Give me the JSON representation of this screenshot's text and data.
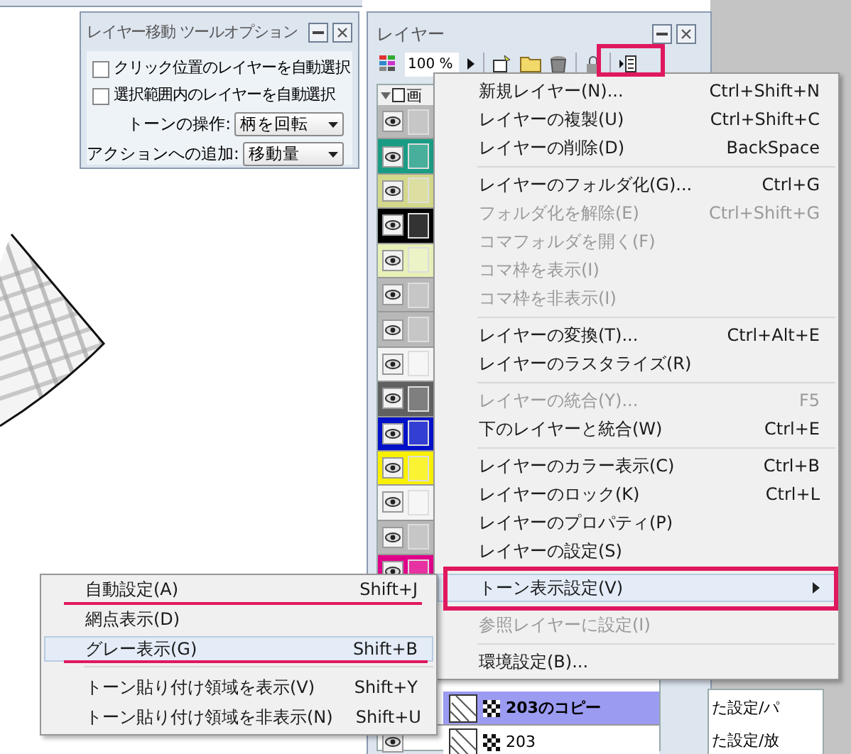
{
  "tool_options": {
    "title": "レイヤー移動 ツールオプション",
    "checkboxes": [
      {
        "label": "クリック位置のレイヤーを自動選択",
        "checked": false
      },
      {
        "label": "選択範囲内のレイヤーを自動選択",
        "checked": false
      }
    ],
    "selects": [
      {
        "label": "トーンの操作:",
        "value": "柄を回転"
      },
      {
        "label": "アクションへの追加:",
        "value": "移動量"
      }
    ]
  },
  "layer_panel": {
    "title": "レイヤー",
    "opacity": "100 %",
    "header": "画",
    "swatches": [
      {
        "color": "#b8b8b8"
      },
      {
        "color": "#1a9c84"
      },
      {
        "color": "#d4d88a"
      },
      {
        "color": "#000000"
      },
      {
        "color": "#e8f0b8"
      },
      {
        "color": "#b8b8b8"
      },
      {
        "color": "#b8b8b8"
      },
      {
        "color": "#f4f4f4"
      },
      {
        "color": "#606060"
      },
      {
        "color": "#0010c8"
      },
      {
        "color": "#f8f000"
      },
      {
        "color": "#f4f4f4"
      },
      {
        "color": "#b8b8b8"
      },
      {
        "color": "#e0008a"
      }
    ],
    "layers": [
      {
        "name": "203のコピー",
        "selected": true
      },
      {
        "name": "203",
        "selected": false
      }
    ]
  },
  "side_panel": {
    "lines": [
      "た設定/パ",
      "た設定/放"
    ]
  },
  "context_menu": {
    "items": [
      {
        "kind": "item",
        "label": "新規レイヤー(N)...",
        "shortcut": "Ctrl+Shift+N",
        "disabled": false,
        "selected": false
      },
      {
        "kind": "item",
        "label": "レイヤーの複製(U)",
        "shortcut": "Ctrl+Shift+C",
        "disabled": false,
        "selected": false
      },
      {
        "kind": "item",
        "label": "レイヤーの削除(D)",
        "shortcut": "BackSpace",
        "disabled": false,
        "selected": false
      },
      {
        "kind": "separator"
      },
      {
        "kind": "item",
        "label": "レイヤーのフォルダ化(G)...",
        "shortcut": "Ctrl+G",
        "disabled": false,
        "selected": false
      },
      {
        "kind": "item",
        "label": "フォルダ化を解除(E)",
        "shortcut": "Ctrl+Shift+G",
        "disabled": true,
        "selected": false
      },
      {
        "kind": "item",
        "label": "コマフォルダを開く(F)",
        "disabled": true,
        "selected": false
      },
      {
        "kind": "item",
        "label": "コマ枠を表示(I)",
        "disabled": true,
        "selected": false
      },
      {
        "kind": "item",
        "label": "コマ枠を非表示(I)",
        "disabled": true,
        "selected": false
      },
      {
        "kind": "separator"
      },
      {
        "kind": "item",
        "label": "レイヤーの変換(T)...",
        "shortcut": "Ctrl+Alt+E",
        "disabled": false,
        "selected": false
      },
      {
        "kind": "item",
        "label": "レイヤーのラスタライズ(R)",
        "disabled": false,
        "selected": false
      },
      {
        "kind": "separator"
      },
      {
        "kind": "item",
        "label": "レイヤーの統合(Y)...",
        "shortcut": "F5",
        "disabled": true,
        "selected": false
      },
      {
        "kind": "item",
        "label": "下のレイヤーと統合(W)",
        "shortcut": "Ctrl+E",
        "disabled": false,
        "selected": false
      },
      {
        "kind": "separator"
      },
      {
        "kind": "item",
        "label": "レイヤーのカラー表示(C)",
        "shortcut": "Ctrl+B",
        "disabled": false,
        "selected": false
      },
      {
        "kind": "item",
        "label": "レイヤーのロック(K)",
        "shortcut": "Ctrl+L",
        "disabled": false,
        "selected": false
      },
      {
        "kind": "item",
        "label": "レイヤーのプロパティ(P)",
        "disabled": false,
        "selected": false
      },
      {
        "kind": "item",
        "label": "レイヤーの設定(S)",
        "disabled": false,
        "selected": false
      },
      {
        "kind": "separator"
      },
      {
        "kind": "submenu",
        "label": "トーン表示設定(V)",
        "disabled": false,
        "selected": true
      },
      {
        "kind": "separator"
      },
      {
        "kind": "item",
        "label": "参照レイヤーに設定(I)",
        "disabled": true,
        "selected": false
      },
      {
        "kind": "separator"
      },
      {
        "kind": "item",
        "label": "環境設定(B)...",
        "disabled": false,
        "selected": false
      }
    ]
  },
  "submenu": {
    "items": [
      {
        "kind": "item",
        "label": "自動設定(A)",
        "shortcut": "Shift+J",
        "selected": false
      },
      {
        "kind": "item",
        "label": "網点表示(D)",
        "selected": false
      },
      {
        "kind": "item",
        "label": "グレー表示(G)",
        "shortcut": "Shift+B",
        "selected": true
      },
      {
        "kind": "separator"
      },
      {
        "kind": "item",
        "label": "トーン貼り付け領域を表示(V)",
        "shortcut": "Shift+Y",
        "selected": false
      },
      {
        "kind": "item",
        "label": "トーン貼り付け領域を非表示(N)",
        "shortcut": "Shift+U",
        "selected": false
      }
    ]
  }
}
